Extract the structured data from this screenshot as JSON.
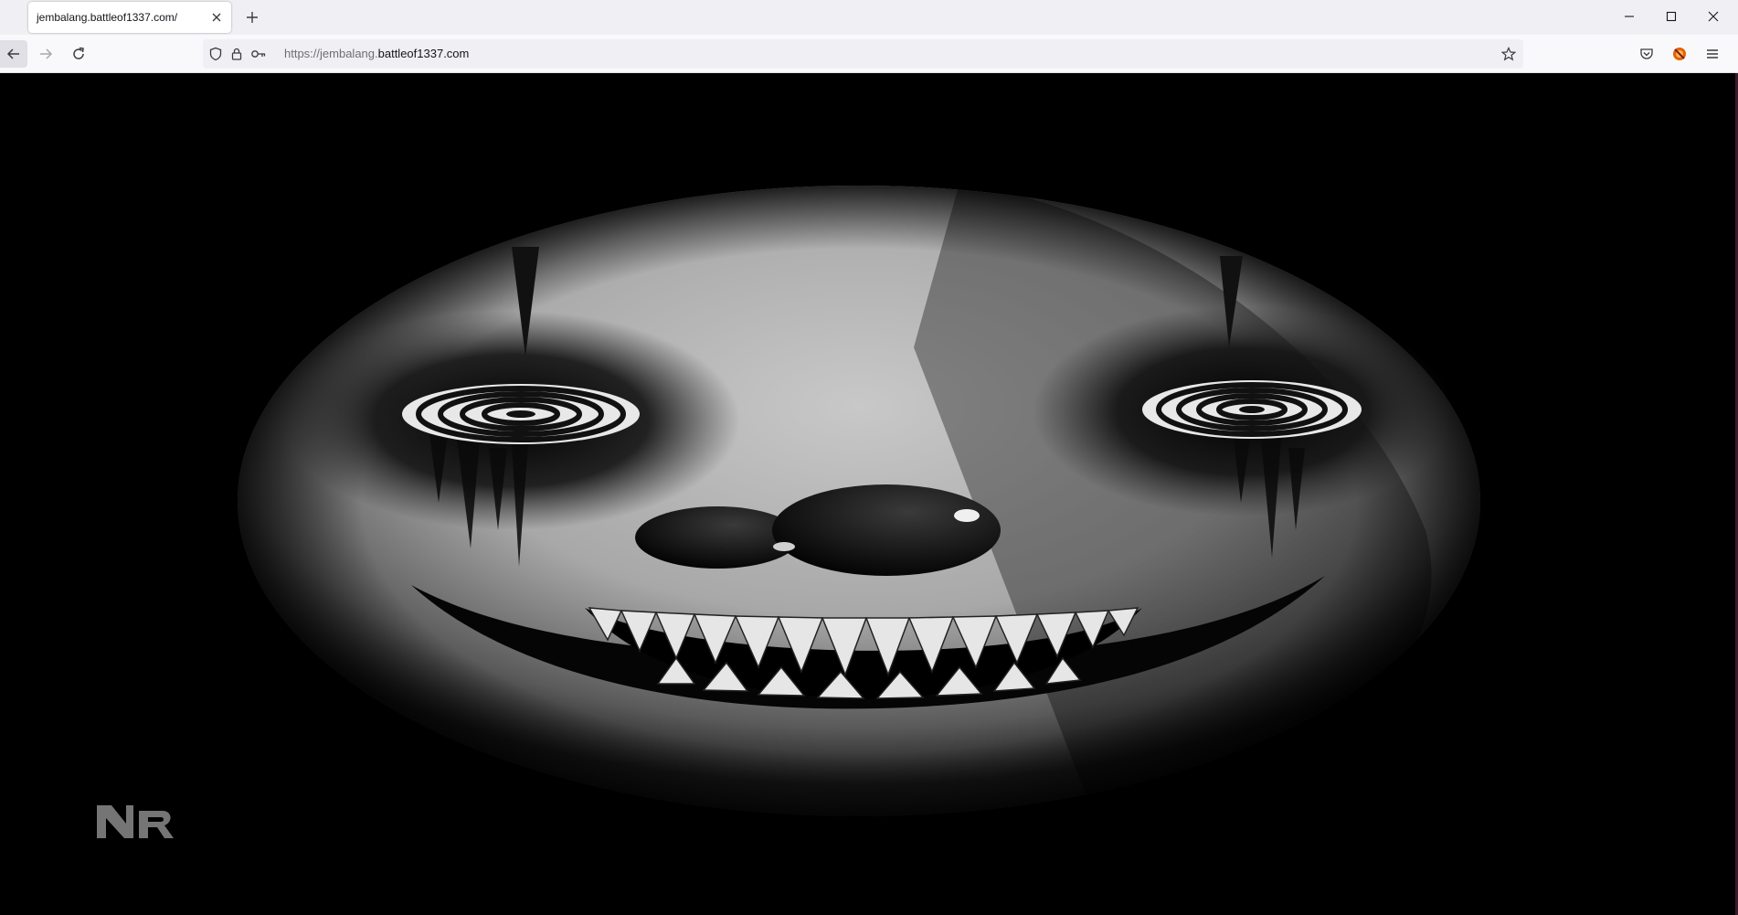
{
  "tab": {
    "title": "jembalang.battleof1337.com/"
  },
  "window_controls": {
    "icons": [
      "minimize-icon",
      "maximize-icon",
      "close-icon"
    ]
  },
  "navbar": {
    "url_prefix": "https://jembalang.",
    "url_domain": "battleof1337.com"
  },
  "page": {
    "background_color": "#000000",
    "image_subject": "clown-face",
    "logo_text": "NR"
  },
  "colors": {
    "tabstrip": "#f0f0f4",
    "toolbar": "#f9f9fb",
    "urlbar": "#f0f0f4",
    "icon": "#3b3b40"
  }
}
